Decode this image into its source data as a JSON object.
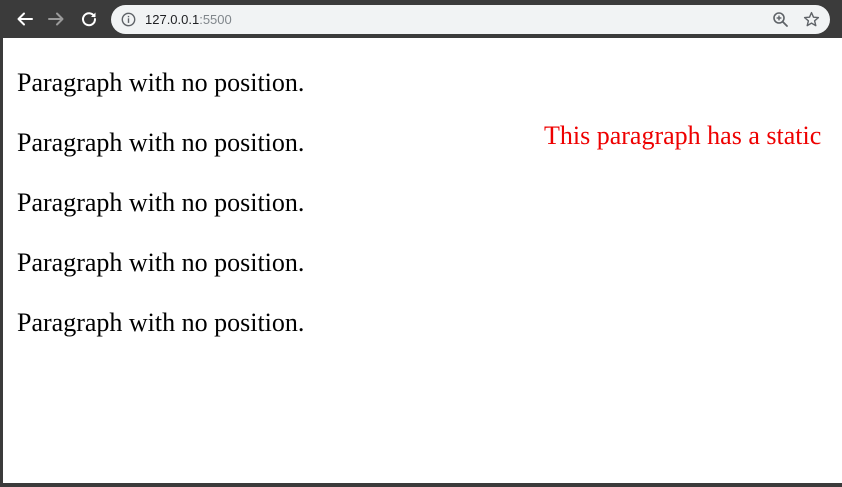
{
  "browser": {
    "address_host": "127.0.0.1",
    "address_port": ":5500",
    "icons": {
      "back": "arrow-left-icon",
      "forward": "arrow-right-icon",
      "reload": "reload-icon",
      "site_info": "info-icon",
      "zoom": "zoom-icon",
      "bookmark": "star-icon"
    }
  },
  "page": {
    "paragraphs": [
      "Paragraph with no position.",
      "Paragraph with no position.",
      "Paragraph with no position.",
      "Paragraph with no position.",
      "Paragraph with no position."
    ],
    "static_paragraph": "This paragraph has a static",
    "colors": {
      "text": "#000000",
      "static_text": "#ee0000"
    }
  }
}
